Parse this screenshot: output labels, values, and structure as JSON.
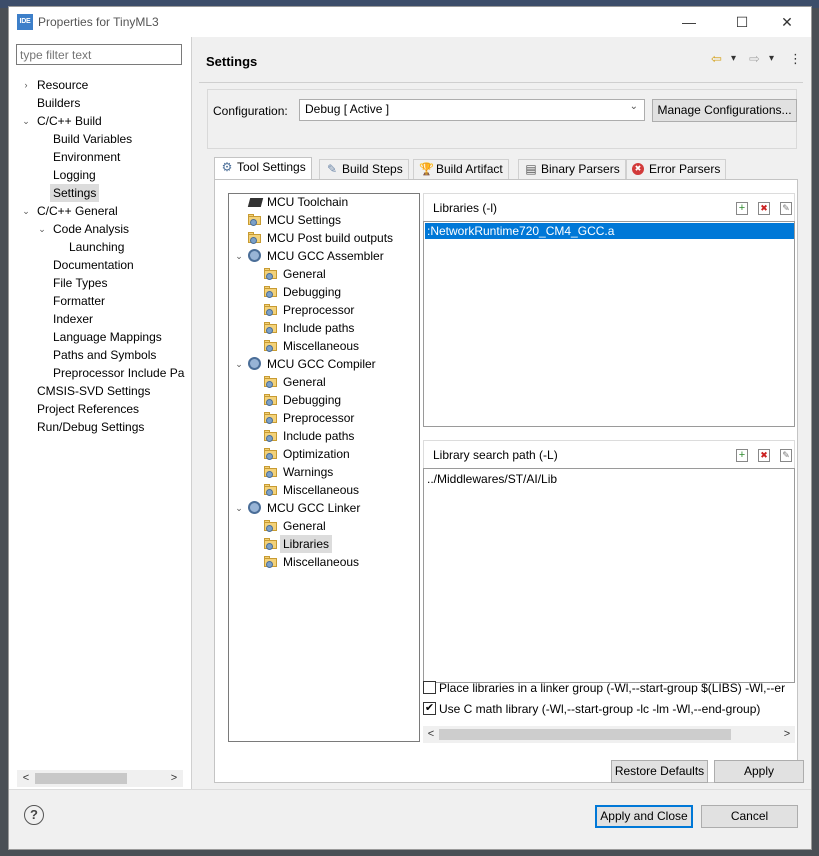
{
  "window": {
    "app_badge": "IDE",
    "title": "Properties for TinyML3",
    "minimize": "—",
    "maximize": "☐",
    "close": "✕"
  },
  "left_pane": {
    "filter_placeholder": "type filter text",
    "tree": [
      {
        "label": "Resource",
        "depth": 0,
        "expander": "›"
      },
      {
        "label": "Builders",
        "depth": 0,
        "expander": ""
      },
      {
        "label": "C/C++ Build",
        "depth": 0,
        "expander": "⌄"
      },
      {
        "label": "Build Variables",
        "depth": 1,
        "expander": ""
      },
      {
        "label": "Environment",
        "depth": 1,
        "expander": ""
      },
      {
        "label": "Logging",
        "depth": 1,
        "expander": ""
      },
      {
        "label": "Settings",
        "depth": 1,
        "expander": "",
        "selected": true
      },
      {
        "label": "C/C++ General",
        "depth": 0,
        "expander": "⌄"
      },
      {
        "label": "Code Analysis",
        "depth": 1,
        "expander": "⌄"
      },
      {
        "label": "Launching",
        "depth": 2,
        "expander": ""
      },
      {
        "label": "Documentation",
        "depth": 1,
        "expander": ""
      },
      {
        "label": "File Types",
        "depth": 1,
        "expander": ""
      },
      {
        "label": "Formatter",
        "depth": 1,
        "expander": ""
      },
      {
        "label": "Indexer",
        "depth": 1,
        "expander": ""
      },
      {
        "label": "Language Mappings",
        "depth": 1,
        "expander": ""
      },
      {
        "label": "Paths and Symbols",
        "depth": 1,
        "expander": ""
      },
      {
        "label": "Preprocessor Include Pa",
        "depth": 1,
        "expander": ""
      },
      {
        "label": "CMSIS-SVD Settings",
        "depth": 0,
        "expander": ""
      },
      {
        "label": "Project References",
        "depth": 0,
        "expander": ""
      },
      {
        "label": "Run/Debug Settings",
        "depth": 0,
        "expander": ""
      }
    ],
    "scroll_left": "<",
    "scroll_right": ">"
  },
  "settings": {
    "title": "Settings",
    "nav_back": "⇦",
    "nav_back_menu": "▾",
    "nav_forward": "⇨",
    "nav_forward_menu": "▾",
    "more": "⋮",
    "configuration_label": "Configuration:",
    "configuration_value": "Debug  [ Active ]",
    "manage_button": "Manage Configurations..."
  },
  "tabs": [
    {
      "label": "Tool Settings",
      "icon": "⚙",
      "active": true
    },
    {
      "label": "Build Steps",
      "icon": "✎",
      "active": false
    },
    {
      "label": "Build Artifact",
      "icon": "🏆",
      "active": false
    },
    {
      "label": "Binary Parsers",
      "icon": "▤",
      "active": false
    },
    {
      "label": "Error Parsers",
      "icon": "✖",
      "active": false
    }
  ],
  "tool_tree": [
    {
      "label": "MCU Toolchain",
      "depth": 0,
      "icon": "chip",
      "expander": ""
    },
    {
      "label": "MCU Settings",
      "depth": 0,
      "icon": "folder-gear",
      "expander": ""
    },
    {
      "label": "MCU Post build outputs",
      "depth": 0,
      "icon": "folder-gear",
      "expander": ""
    },
    {
      "label": "MCU GCC Assembler",
      "depth": 0,
      "icon": "gear",
      "expander": "⌄"
    },
    {
      "label": "General",
      "depth": 1,
      "icon": "folder-gear",
      "expander": ""
    },
    {
      "label": "Debugging",
      "depth": 1,
      "icon": "folder-gear",
      "expander": ""
    },
    {
      "label": "Preprocessor",
      "depth": 1,
      "icon": "folder-gear",
      "expander": ""
    },
    {
      "label": "Include paths",
      "depth": 1,
      "icon": "folder-gear",
      "expander": ""
    },
    {
      "label": "Miscellaneous",
      "depth": 1,
      "icon": "folder-gear",
      "expander": ""
    },
    {
      "label": "MCU GCC Compiler",
      "depth": 0,
      "icon": "gear",
      "expander": "⌄"
    },
    {
      "label": "General",
      "depth": 1,
      "icon": "folder-gear",
      "expander": ""
    },
    {
      "label": "Debugging",
      "depth": 1,
      "icon": "folder-gear",
      "expander": ""
    },
    {
      "label": "Preprocessor",
      "depth": 1,
      "icon": "folder-gear",
      "expander": ""
    },
    {
      "label": "Include paths",
      "depth": 1,
      "icon": "folder-gear",
      "expander": ""
    },
    {
      "label": "Optimization",
      "depth": 1,
      "icon": "folder-gear",
      "expander": ""
    },
    {
      "label": "Warnings",
      "depth": 1,
      "icon": "folder-gear",
      "expander": ""
    },
    {
      "label": "Miscellaneous",
      "depth": 1,
      "icon": "folder-gear",
      "expander": ""
    },
    {
      "label": "MCU GCC Linker",
      "depth": 0,
      "icon": "gear",
      "expander": "⌄"
    },
    {
      "label": "General",
      "depth": 1,
      "icon": "folder-gear",
      "expander": ""
    },
    {
      "label": "Libraries",
      "depth": 1,
      "icon": "folder-gear",
      "expander": "",
      "selected": true
    },
    {
      "label": "Miscellaneous",
      "depth": 1,
      "icon": "folder-gear",
      "expander": ""
    }
  ],
  "libraries": {
    "header": "Libraries (-l)",
    "items": [
      ":NetworkRuntime720_CM4_GCC.a"
    ],
    "icon_add": "+",
    "icon_delete": "✖",
    "icon_edit": "✎"
  },
  "library_paths": {
    "header": "Library search path (-L)",
    "items": [
      "../Middlewares/ST/AI/Lib"
    ],
    "icon_add": "+",
    "icon_delete": "✖",
    "icon_edit": "✎"
  },
  "options": {
    "linker_group_label": "Place libraries in a linker group (-Wl,--start-group $(LIBS) -Wl,--er",
    "linker_group_checked": false,
    "math_label": "Use C math library (-Wl,--start-group -lc -lm -Wl,--end-group)",
    "math_checked": true,
    "check_mark": "✔",
    "scroll_left": "<",
    "scroll_right": ">"
  },
  "panel_buttons": {
    "restore_defaults": "Restore Defaults",
    "apply": "Apply"
  },
  "dialog_buttons": {
    "help": "?",
    "apply_and_close": "Apply and Close",
    "cancel": "Cancel"
  },
  "colors": {
    "selection": "#0078d7",
    "tree_selection": "#dcdcdc",
    "app_badge": "#3d7fc9"
  }
}
